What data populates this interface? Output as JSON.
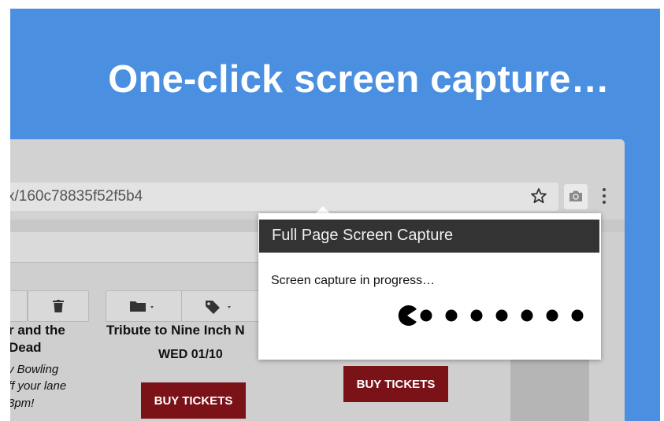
{
  "headline": "One-click screen capture…",
  "browser": {
    "url_fragment": "x/160c78835f52f5b4",
    "icons": [
      "star-icon",
      "camera-icon",
      "kebab-menu-icon",
      "trash-icon",
      "folder-icon",
      "tag-icon"
    ]
  },
  "page": {
    "event_left_line1": "r and the",
    "event_left_line2": "Dead",
    "event_left_italic1": "y Bowling",
    "event_left_italic2": "ff your lane",
    "event_left_italic3": "3pm!",
    "event_mid_title": "Tribute to Nine Inch N",
    "event_mid_date": "WED 01/10",
    "buy_left": "BUY TICKETS",
    "buy_right": "BUY TICKETS"
  },
  "popup": {
    "title": "Full Page Screen Capture",
    "status": "Screen capture in progress…",
    "progress_dots": 7
  },
  "colors": {
    "background": "#4a8fe0",
    "popup_header": "#333333",
    "ticket_button": "#7a1218"
  }
}
